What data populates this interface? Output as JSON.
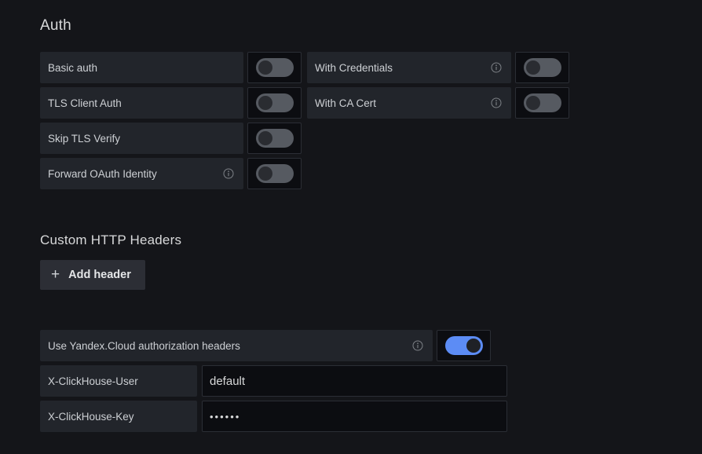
{
  "auth": {
    "title": "Auth",
    "left_rows": [
      {
        "label": "Basic auth",
        "info": false,
        "toggle": "off",
        "icon": "toggle-icon"
      },
      {
        "label": "TLS Client Auth",
        "info": false,
        "toggle": "off",
        "icon": "toggle-icon"
      },
      {
        "label": "Skip TLS Verify",
        "info": false,
        "toggle": "off",
        "icon": "toggle-icon"
      },
      {
        "label": "Forward OAuth Identity",
        "info": true,
        "toggle": "off",
        "icon": "toggle-icon"
      }
    ],
    "right_rows": [
      {
        "label": "With Credentials",
        "info": true,
        "toggle": "off",
        "icon": "toggle-icon"
      },
      {
        "label": "With CA Cert",
        "info": true,
        "toggle": "off",
        "icon": "toggle-icon"
      }
    ],
    "info_icon_name": "info-icon"
  },
  "custom_headers": {
    "title": "Custom HTTP Headers",
    "add_button": {
      "label": "Add header",
      "plus": "+",
      "icon": "plus-icon"
    }
  },
  "yandex": {
    "label": "Use Yandex.Cloud authorization headers",
    "toggle": "on",
    "info": true,
    "rows": [
      {
        "key": "X-ClickHouse-User",
        "value": "default",
        "placeholder": "",
        "masked": false
      },
      {
        "key": "X-ClickHouse-Key",
        "value": "••••••",
        "placeholder": "",
        "masked": true
      }
    ]
  },
  "colors": {
    "page_background": "#141519",
    "row_background": "#22252b",
    "input_background": "#0c0d11",
    "toggle_on": "#5c8cf5",
    "toggle_off": "#565a61",
    "text": "#d8d9da",
    "button_background": "#2c2e35"
  }
}
